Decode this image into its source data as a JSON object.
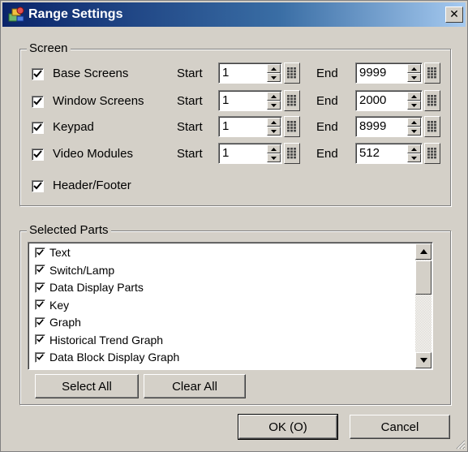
{
  "window": {
    "title": "Range Settings"
  },
  "screen_group": {
    "legend": "Screen",
    "start_label": "Start",
    "end_label": "End",
    "rows": [
      {
        "label": "Base Screens",
        "checked": true,
        "start": "1",
        "end": "9999"
      },
      {
        "label": "Window Screens",
        "checked": true,
        "start": "1",
        "end": "2000"
      },
      {
        "label": "Keypad",
        "checked": true,
        "start": "1",
        "end": "8999"
      },
      {
        "label": "Video Modules",
        "checked": true,
        "start": "1",
        "end": "512"
      }
    ],
    "header_footer": {
      "label": "Header/Footer",
      "checked": true
    }
  },
  "parts_group": {
    "legend": "Selected Parts",
    "items": [
      {
        "label": "Text",
        "checked": true
      },
      {
        "label": "Switch/Lamp",
        "checked": true
      },
      {
        "label": "Data Display Parts",
        "checked": true
      },
      {
        "label": "Key",
        "checked": true
      },
      {
        "label": "Graph",
        "checked": true
      },
      {
        "label": "Historical Trend Graph",
        "checked": true
      },
      {
        "label": "Data Block Display Graph",
        "checked": true
      }
    ],
    "select_all_label": "Select All",
    "clear_all_label": "Clear All"
  },
  "footer": {
    "ok_label": "OK (O)",
    "cancel_label": "Cancel"
  },
  "icons": {
    "app": "range-settings-app-icon",
    "close": "close-icon",
    "check": "checkmark-icon",
    "spin_up": "spin-up-arrow-icon",
    "spin_down": "spin-down-arrow-icon",
    "keypad": "keypad-icon",
    "scroll_up": "scroll-up-arrow-icon",
    "scroll_down": "scroll-down-arrow-icon",
    "resize": "resize-grip-icon"
  },
  "colors": {
    "title_start": "#0a246a",
    "title_end": "#a6caf0",
    "face": "#d4d0c8"
  }
}
